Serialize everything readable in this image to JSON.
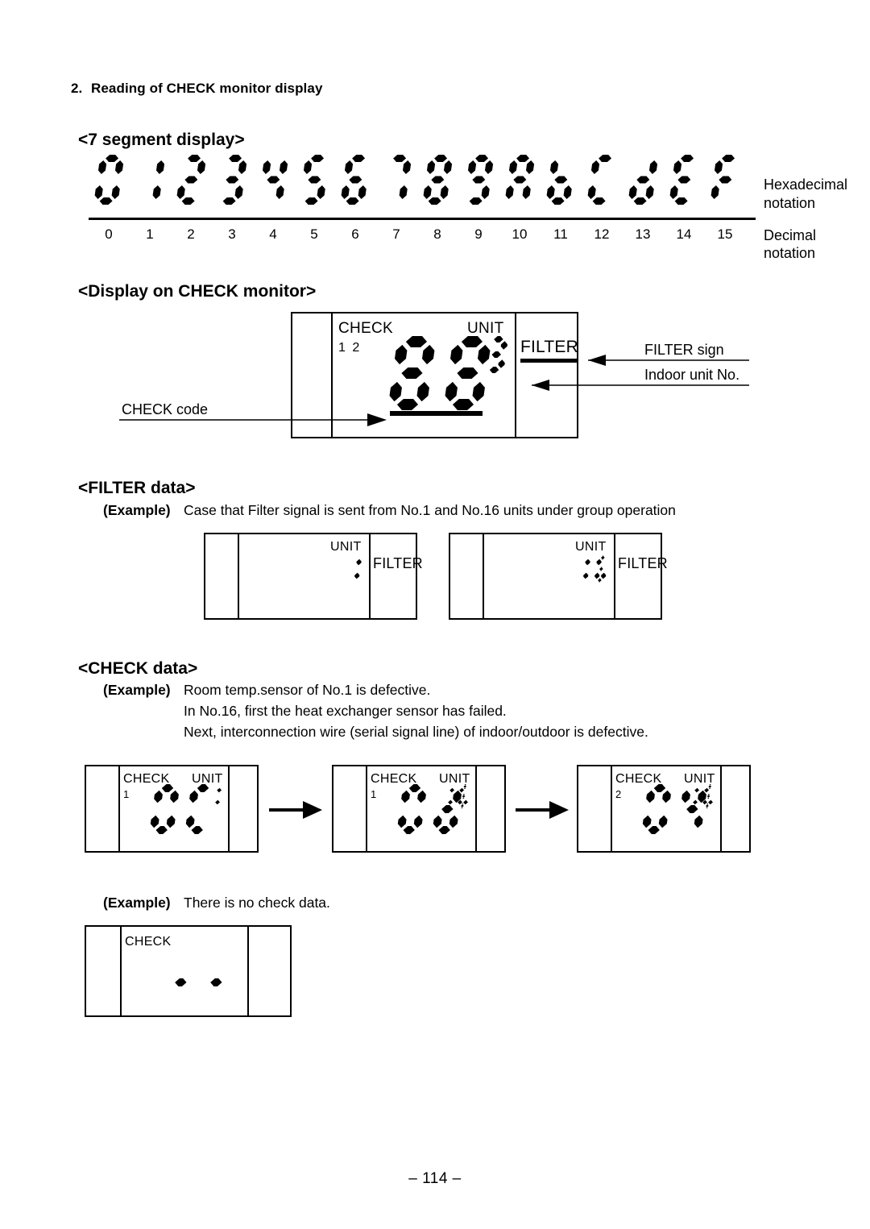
{
  "document": {
    "section_number": "2.",
    "section_title": "Reading of CHECK monitor display",
    "page_footer": "– 114 –"
  },
  "seven_segment_section": {
    "heading": "<7 segment display>",
    "hex_characters": [
      "0",
      "1",
      "2",
      "3",
      "4",
      "5",
      "6",
      "7",
      "8",
      "9",
      "A",
      "b",
      "C",
      "d",
      "E",
      "F"
    ],
    "decimal_values": [
      "0",
      "1",
      "2",
      "3",
      "4",
      "5",
      "6",
      "7",
      "8",
      "9",
      "10",
      "11",
      "12",
      "13",
      "14",
      "15"
    ],
    "hexadecimal_label_line1": "Hexadecimal",
    "hexadecimal_label_line2": "notation",
    "decimal_label": "Decimal notation"
  },
  "check_monitor_section": {
    "heading": "<Display on CHECK monitor>",
    "lcd": {
      "check_label": "CHECK",
      "unit_label": "UNIT",
      "indicator_digits": "1 2",
      "filter_label": "FILTER",
      "check_code": "88",
      "unit_number": "3"
    },
    "annotations": {
      "check_code": "CHECK code",
      "filter_sign": "FILTER sign",
      "indoor_unit_no": "Indoor unit No."
    }
  },
  "filter_data_section": {
    "heading": "<FILTER data>",
    "example_label": "(Example)",
    "example_text": "Case that Filter signal is sent from No.1 and No.16 units under group operation",
    "panels": [
      {
        "unit_label": "UNIT",
        "unit_number": "1",
        "filter_label": "FILTER"
      },
      {
        "unit_label": "UNIT",
        "unit_number": "16",
        "filter_label": "FILTER"
      }
    ]
  },
  "check_data_section": {
    "heading": "<CHECK data>",
    "example_label": "(Example)",
    "example_lines": [
      "Room temp.sensor of No.1 is defective.",
      "In No.16, first the heat exchanger sensor has failed.",
      "Next, interconnection wire (serial signal line) of indoor/outdoor is defective."
    ],
    "panels": [
      {
        "check_label": "CHECK",
        "unit_label": "UNIT",
        "indicator": "1",
        "code": "0C",
        "unit_number": "1"
      },
      {
        "check_label": "CHECK",
        "unit_label": "UNIT",
        "indicator": "1",
        "code": "0d",
        "unit_number": "16"
      },
      {
        "check_label": "CHECK",
        "unit_label": "UNIT",
        "indicator": "2",
        "code": "04",
        "unit_number": "16"
      }
    ]
  },
  "no_check_data_section": {
    "example_label": "(Example)",
    "example_text": "There is no check data.",
    "panel": {
      "check_label": "CHECK",
      "code": "--"
    }
  },
  "colors": {
    "ink": "#000000",
    "paper": "#ffffff"
  }
}
